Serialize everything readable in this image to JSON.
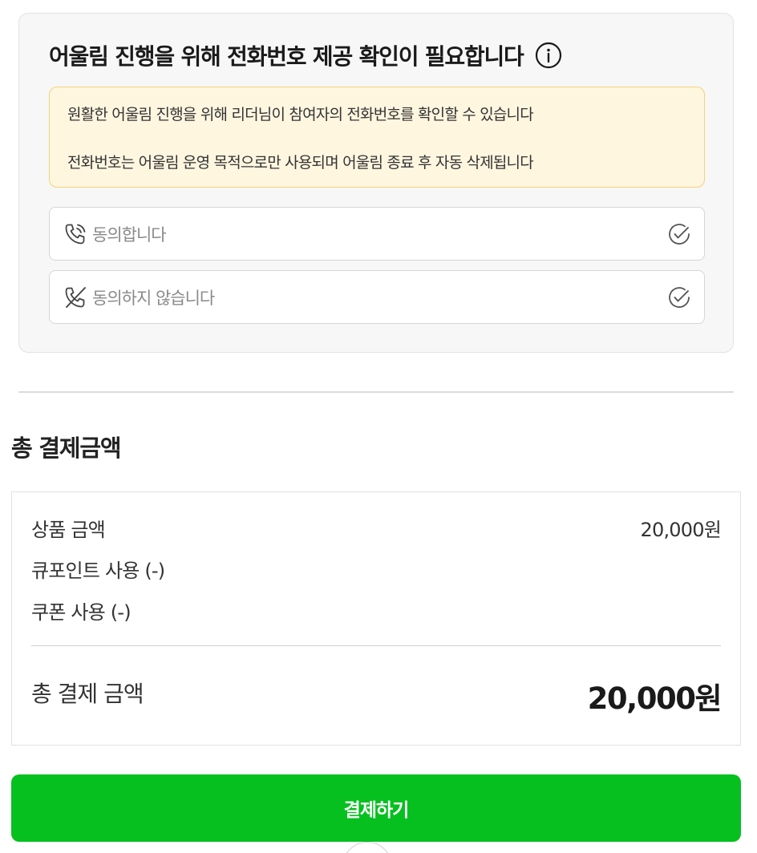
{
  "consent": {
    "title": "어울림 진행을 위해 전화번호 제공 확인이 필요합니다",
    "info_icon": "info-circle-icon",
    "notice_lines": [
      "원활한 어울림 진행을 위해 리더님이 참여자의 전화번호를 확인할 수 있습니다",
      "전화번호는 어울림 운영 목적으로만 사용되며 어울림 종료 후 자동 삭제됩니다"
    ],
    "options": [
      {
        "label": "동의합니다",
        "icon": "phone-icon",
        "check_icon": "check-circle-icon"
      },
      {
        "label": "동의하지 않습니다",
        "icon": "phone-off-icon",
        "check_icon": "check-circle-icon"
      }
    ]
  },
  "payment": {
    "heading": "총 결제금액",
    "rows": [
      {
        "label": "상품 금액",
        "value": "20,000원"
      },
      {
        "label": "큐포인트 사용 (-)",
        "value": ""
      },
      {
        "label": "쿠폰 사용 (-)",
        "value": ""
      }
    ],
    "total_label": "총 결제 금액",
    "total_value": "20,000원",
    "button_label": "결제하기"
  },
  "colors": {
    "accent_green": "#06c01f",
    "notice_bg": "#fff6e0",
    "notice_border": "#f3d27a"
  }
}
